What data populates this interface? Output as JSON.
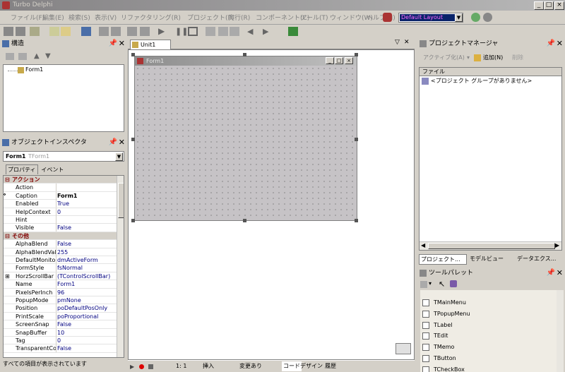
{
  "app_title": "Turbo Delphi",
  "window_controls": {
    "minimize": "_",
    "maximize": "□",
    "close": "×"
  },
  "menu": [
    "ファイル(F)",
    "編集(E)",
    "検索(S)",
    "表示(V)",
    "リファクタリング(R)",
    "プロジェクト(P)",
    "実行(R)",
    "コンポーネント(C)",
    "ツール(T)",
    "ウィンドウ(W)",
    "ヘルプ(H)"
  ],
  "layout_select": "Default Layout",
  "structure": {
    "title": "構造",
    "tree_item": "Form1"
  },
  "object_inspector": {
    "title": "オブジェクトインスペクタ",
    "selected_name": "Form1",
    "selected_type": "TForm1",
    "tabs": [
      "プロパティ",
      "イベント"
    ],
    "rows": [
      {
        "cat": true,
        "label": "アクション",
        "sign": "⊟"
      },
      {
        "key": "Action",
        "value": ""
      },
      {
        "key": "Caption",
        "value": "Form1",
        "selected": true
      },
      {
        "key": "Enabled",
        "value": "True"
      },
      {
        "key": "HelpContext",
        "value": "0"
      },
      {
        "key": "Hint",
        "value": ""
      },
      {
        "key": "Visible",
        "value": "False"
      },
      {
        "cat": true,
        "label": "その他",
        "sign": "⊟"
      },
      {
        "key": "AlphaBlend",
        "value": "False"
      },
      {
        "key": "AlphaBlendValue",
        "value": "255"
      },
      {
        "key": "DefaultMonitor",
        "value": "dmActiveForm"
      },
      {
        "key": "FormStyle",
        "value": "fsNormal"
      },
      {
        "key": "HorzScrollBar",
        "value": "(TControlScrollBar)",
        "expand": "⊞"
      },
      {
        "key": "Name",
        "value": "Form1"
      },
      {
        "key": "PixelsPerInch",
        "value": "96"
      },
      {
        "key": "PopupMode",
        "value": "pmNone"
      },
      {
        "key": "Position",
        "value": "poDefaultPosOnly"
      },
      {
        "key": "PrintScale",
        "value": "poProportional"
      },
      {
        "key": "ScreenSnap",
        "value": "False"
      },
      {
        "key": "SnapBuffer",
        "value": "10"
      },
      {
        "key": "Tag",
        "value": "0"
      },
      {
        "key": "TransparentColor",
        "value": "False"
      }
    ],
    "status": "すべての項目が表示されています"
  },
  "editor": {
    "tab": "Unit1",
    "form_caption": "Form1",
    "status": {
      "position": "1:  1",
      "mode": "挿入",
      "modified": "変更あり"
    },
    "bottom_tabs": [
      "コード",
      "デザイン",
      "履歴"
    ]
  },
  "project_manager": {
    "title": "プロジェクトマネージャ",
    "buttons": {
      "activate": "アクティブ化(A)",
      "add": "追加(N)",
      "remove": "削除"
    },
    "column_header": "ファイル",
    "empty_text": "<プロジェクト グループがありません>",
    "tabs": [
      "プロジェクト...",
      "モデルビュー",
      "データエクス..."
    ]
  },
  "tool_palette": {
    "title": "ツールパレット",
    "items": [
      "TMainMenu",
      "TPopupMenu",
      "TLabel",
      "TEdit",
      "TMemo",
      "TButton",
      "TCheckBox"
    ]
  }
}
